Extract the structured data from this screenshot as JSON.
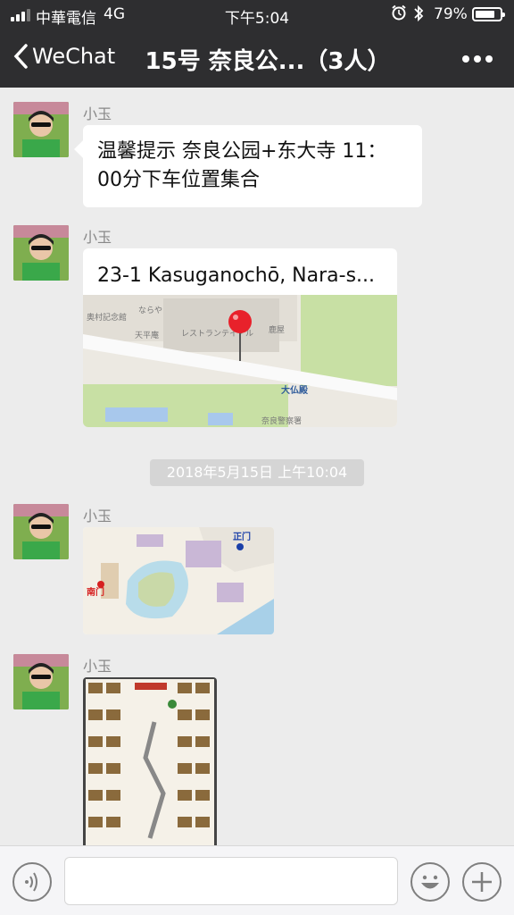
{
  "status_bar": {
    "carrier": "中華電信",
    "network": "4G",
    "time": "下午5:04",
    "battery": "79%",
    "battery_level": 0.79
  },
  "nav": {
    "back_label": "WeChat",
    "title": "15号 奈良公...（3人）"
  },
  "messages": [
    {
      "type": "text",
      "sender": "小玉",
      "text": "温馨提示 奈良公园+东大寺 11：00分下车位置集合"
    },
    {
      "type": "location",
      "sender": "小玉",
      "address": "23-1 Kasuganochō, Nara-s...",
      "map_labels": [
        "奥村記念館",
        "ならや",
        "天平庵",
        "レストランテイ・ル",
        "鹿屋",
        "大仏殿",
        "奈良警察署"
      ]
    },
    {
      "type": "timestamp",
      "text": "2018年5月15日 上午10:04"
    },
    {
      "type": "image",
      "sender": "小玉",
      "image_desc": "temple map",
      "labels": [
        "正门",
        "南门"
      ]
    },
    {
      "type": "image",
      "sender": "小玉",
      "image_desc": "shop poster"
    }
  ],
  "input_bar": {
    "voice_icon": "voice-icon",
    "emoji_icon": "emoji-icon",
    "plus_icon": "plus-icon"
  },
  "colors": {
    "topbar": "#2e2e30",
    "chat_bg": "#ececec",
    "bubble": "#ffffff"
  }
}
